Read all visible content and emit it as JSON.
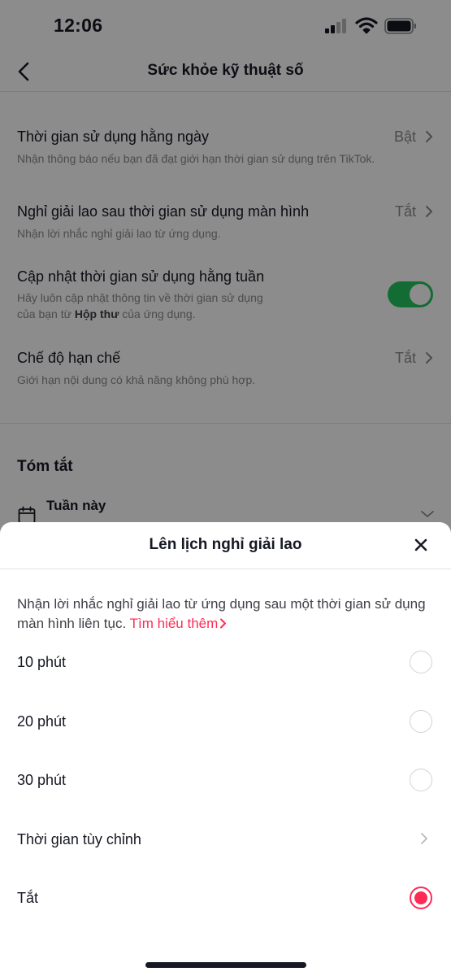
{
  "status_bar": {
    "time": "12:06"
  },
  "header": {
    "title": "Sức khỏe kỹ thuật số"
  },
  "settings": [
    {
      "title": "Thời gian sử dụng hằng ngày",
      "value": "Bật",
      "description": "Nhận thông báo nếu bạn đã đạt giới hạn thời gian sử dụng trên TikTok."
    },
    {
      "title": "Nghỉ giải lao sau thời gian sử dụng màn hình",
      "value": "Tắt",
      "description": "Nhận lời nhắc nghỉ giải lao từ ứng dụng."
    },
    {
      "title": "Cập nhật thời gian sử dụng hằng tuần",
      "description_line1": "Hãy luôn cập nhật thông tin về thời gian sử dụng",
      "description_prefix": "của bạn từ ",
      "description_bold": "Hộp thư",
      "description_suffix": " của ứng dụng.",
      "toggle_on": true
    },
    {
      "title": "Chế độ hạn chế",
      "value": "Tắt",
      "description": "Giới hạn nội dung có khả năng không phù hợp."
    }
  ],
  "summary": {
    "title": "Tóm tắt",
    "period": "Tuần này"
  },
  "sheet": {
    "title": "Lên lịch nghỉ giải lao",
    "description": "Nhận lời nhắc nghỉ giải lao từ ứng dụng sau một thời gian sử dụng màn hình liên tục.",
    "learn_more": "Tìm hiểu thêm",
    "options": [
      {
        "label": "10 phút",
        "selected": false
      },
      {
        "label": "20 phút",
        "selected": false
      },
      {
        "label": "30 phút",
        "selected": false
      },
      {
        "label": "Thời gian tùy chỉnh",
        "type": "link"
      },
      {
        "label": "Tắt",
        "selected": true
      }
    ]
  },
  "colors": {
    "accent": "#fe2c55",
    "toggle_on": "#22c55e",
    "text_primary": "#161823",
    "text_secondary": "#8a8b91"
  },
  "icons": [
    "back-arrow-icon",
    "chevron-right-icon",
    "calendar-icon",
    "chevron-down-icon",
    "close-icon",
    "signal-icon",
    "wifi-icon",
    "battery-icon"
  ]
}
